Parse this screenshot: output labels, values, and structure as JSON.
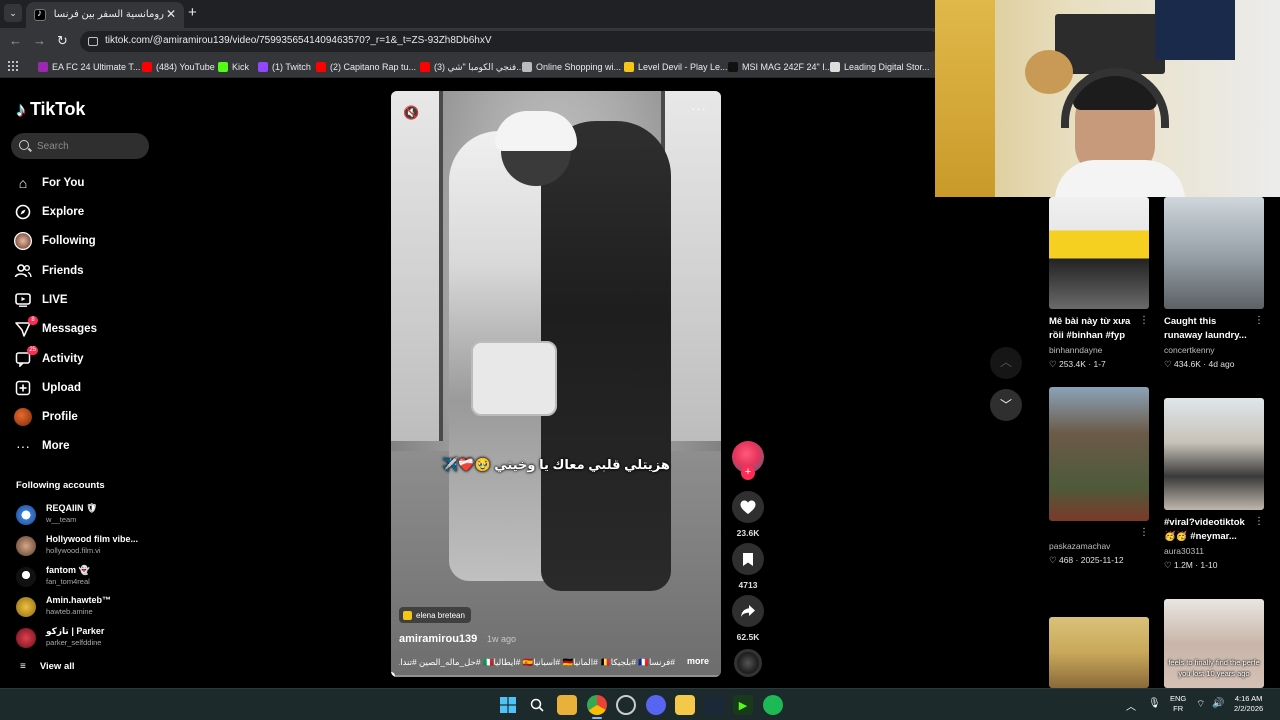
{
  "browser": {
    "tab_title": "رومانسية السفر بين فرنسا وبلجيكا",
    "url": "tiktok.com/@amiramirou139/video/7599356541409463570?_r=1&_t=ZS-93Zh8Db6hxV",
    "bookmarks": [
      {
        "label": "EA FC 24 Ultimate T...",
        "color": "#9c27b0"
      },
      {
        "label": "(484) YouTube",
        "color": "#ff0000"
      },
      {
        "label": "Kick",
        "color": "#53fc18"
      },
      {
        "label": "(1) Twitch",
        "color": "#9146ff"
      },
      {
        "label": "(2) Capitano Rap tu...",
        "color": "#ff0000"
      },
      {
        "label": "(3) فنجي الكومبا \"شي...",
        "color": "#ff0000"
      },
      {
        "label": "Online Shopping wi...",
        "color": "#bbbbbb"
      },
      {
        "label": "Level Devil - Play Le...",
        "color": "#f5c518"
      },
      {
        "label": "MSI MAG 242F 24\" I...",
        "color": "#111111"
      },
      {
        "label": "Leading Digital Stor...",
        "color": "#dddddd"
      }
    ]
  },
  "sidebar": {
    "logo": "TikTok",
    "search_placeholder": "Search",
    "nav": [
      {
        "label": "For You",
        "icon": "home-icon"
      },
      {
        "label": "Explore",
        "icon": "compass-icon"
      },
      {
        "label": "Following",
        "icon": "following-avatar"
      },
      {
        "label": "Friends",
        "icon": "friends-icon"
      },
      {
        "label": "LIVE",
        "icon": "live-icon"
      },
      {
        "label": "Messages",
        "icon": "messages-icon",
        "badge": "8"
      },
      {
        "label": "Activity",
        "icon": "activity-icon",
        "badge": "25"
      },
      {
        "label": "Upload",
        "icon": "upload-icon"
      },
      {
        "label": "Profile",
        "icon": "profile-avatar"
      },
      {
        "label": "More",
        "icon": "more-icon"
      }
    ],
    "following_title": "Following accounts",
    "accounts": [
      {
        "name": "REQAIIN 🛡",
        "handle": "w__team",
        "color": "#3a7bd5"
      },
      {
        "name": "Hollywood film vibe...",
        "handle": "hollywood.film.vi",
        "color": "#8a6a4a"
      },
      {
        "name": "fantom 👻",
        "handle": "fan_tom4real",
        "color": "#111111"
      },
      {
        "name": "Amin.hawteb™",
        "handle": "hawteb.amine",
        "color": "#c9a227"
      },
      {
        "name": "تازكو | Parker",
        "handle": "parker_selfddine",
        "color": "#a11c2c"
      }
    ],
    "view_all": "View all"
  },
  "video": {
    "caption": "هزيتلي قلبي معاك يا وخيتي 🥹❤️‍🩹✈️",
    "sound": "elena bretean",
    "author": "amiramirou139",
    "time": "1w ago",
    "tags": "#فرنسا🇨🇵 #بلجيكا🇧🇪 #المانيا🇩🇪 #اسبانيا🇪🇸 #ايطاليا🇮🇹 #حل_ماله_الصين #تندا...",
    "more": "more",
    "progress": 0.0
  },
  "actions": {
    "likes": "23.6K",
    "saves": "4713",
    "shares": "62.5K"
  },
  "recommended": [
    {
      "title": "Mê bài này từ xưa rồii #binhan #fyp",
      "author": "binhanndayne",
      "meta": "♡ 253.4K · 1-7",
      "bg": "linear-gradient(#f0f0f0 0%, #e8e8e8 30%, #f5d020 30%, #f5d020 55%, #222 55%, #6a6a6a 100%)"
    },
    {
      "title": "Caught this runaway laundry...",
      "author": "concertkenny",
      "meta": "♡ 434.6K · 4d ago",
      "bg": "linear-gradient(#cfd6dc 0%, #9aa3ab 50%, #5c6166 100%)"
    },
    {
      "title": "",
      "author": "paskazamachav",
      "meta": "♡ 468 · 2025-11-12",
      "bg": "linear-gradient(#8aa3b8 0%, #6b5a48 35%, #4e5a3a 75%, #7a3a2a 100%)"
    },
    {
      "title": "#viral?videotiktok 🥳🥳 #neymar...",
      "author": "aura30311",
      "meta": "♡ 1.2M · 1-10",
      "bg": "linear-gradient(#dfe6ea 0%, #c7c2b8 40%, #3a3a3a 70%, #bfb7ad 100%)"
    },
    {
      "title": "",
      "author": "",
      "meta": "",
      "bg": "linear-gradient(#d9c27a 0%, #c9a85a 50%, #8a6a3a 100%)"
    },
    {
      "title": "",
      "author": "",
      "meta": "",
      "bg": "linear-gradient(#e9e6e2 0%, #c9b6aa 50%, #d4c0b4 100%)",
      "overlay": "feels to finally find the perfe you lost 10 years ago"
    }
  ],
  "taskbar": {
    "lang": "ENG",
    "region": "FR",
    "time": "4:16 AM",
    "date": "2/2/2026"
  }
}
